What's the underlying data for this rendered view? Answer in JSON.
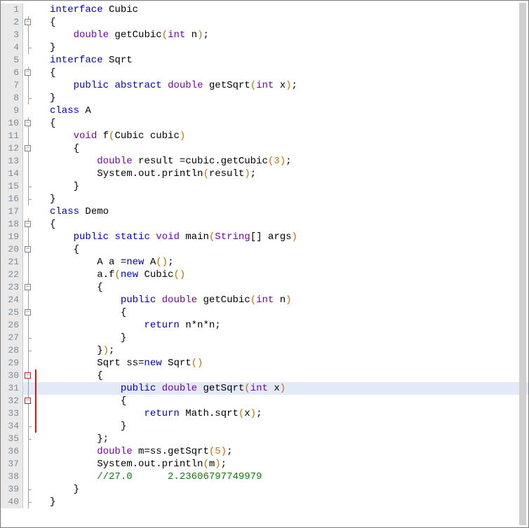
{
  "chart_data": {
    "language": "Java",
    "source": "interface Cubic\n{\n    double getCubic(int n);\n}\ninterface Sqrt\n{\n    public abstract double getSqrt(int x);\n}\nclass A\n{\n    void f(Cubic cubic)\n    {\n        double result =cubic.getCubic(3);\n        System.out.println(result);\n    }\n}\nclass Demo\n{\n    public static void main(String[] args)\n    {\n        A a =new A();\n        a.f(new Cubic()\n        {\n            public double getCubic(int n)\n            {\n                return n*n*n;\n            }\n        });\n        Sqrt ss=new Sqrt()\n        {\n            public double getSqrt(int x)\n            {\n                return Math.sqrt(x);\n            }\n        };\n        double m=ss.getSqrt(5);\n        System.out.println(m);\n        //27.0      2.23606797749979\n    }\n}\n"
  },
  "editor": {
    "highlighted_line": 31,
    "total_lines": 40
  },
  "lines": {
    "l1": {
      "n": "1",
      "t": [
        "interface",
        " Cubic"
      ]
    },
    "l2": {
      "n": "2",
      "t": [
        "{"
      ]
    },
    "l3": {
      "n": "3",
      "t": [
        "    ",
        "double",
        " getCubic",
        "(",
        "int",
        " n",
        ")",
        ";"
      ]
    },
    "l4": {
      "n": "4",
      "t": [
        "}"
      ]
    },
    "l5": {
      "n": "5",
      "t": [
        "interface",
        " Sqrt"
      ]
    },
    "l6": {
      "n": "6",
      "t": [
        "{"
      ]
    },
    "l7": {
      "n": "7",
      "t": [
        "    ",
        "public",
        " ",
        "abstract",
        " ",
        "double",
        " getSqrt",
        "(",
        "int",
        " x",
        ")",
        ";"
      ]
    },
    "l8": {
      "n": "8",
      "t": [
        "}"
      ]
    },
    "l9": {
      "n": "9",
      "t": [
        "class",
        " A"
      ]
    },
    "l10": {
      "n": "10",
      "t": [
        "{"
      ]
    },
    "l11": {
      "n": "11",
      "t": [
        "    ",
        "void",
        " f",
        "(",
        "Cubic cubic",
        ")"
      ]
    },
    "l12": {
      "n": "12",
      "t": [
        "    {"
      ]
    },
    "l13": {
      "n": "13",
      "t": [
        "        ",
        "double",
        " result =cubic.getCubic",
        "(",
        "3",
        ")",
        ";"
      ]
    },
    "l14": {
      "n": "14",
      "t": [
        "        System.out.println",
        "(",
        "result",
        ")",
        ";"
      ]
    },
    "l15": {
      "n": "15",
      "t": [
        "    }"
      ]
    },
    "l16": {
      "n": "16",
      "t": [
        "}"
      ]
    },
    "l17": {
      "n": "17",
      "t": [
        "class",
        " Demo"
      ]
    },
    "l18": {
      "n": "18",
      "t": [
        "{"
      ]
    },
    "l19": {
      "n": "19",
      "t": [
        "    ",
        "public",
        " ",
        "static",
        " ",
        "void",
        " main",
        "(",
        "String",
        "[] args",
        ")"
      ]
    },
    "l20": {
      "n": "20",
      "t": [
        "    {"
      ]
    },
    "l21": {
      "n": "21",
      "t": [
        "        A a =",
        "new",
        " A",
        "()",
        ";"
      ]
    },
    "l22": {
      "n": "22",
      "t": [
        "        a.f",
        "(",
        "new",
        " Cubic",
        "()"
      ]
    },
    "l23": {
      "n": "23",
      "t": [
        "        {"
      ]
    },
    "l24": {
      "n": "24",
      "t": [
        "            ",
        "public",
        " ",
        "double",
        " getCubic",
        "(",
        "int",
        " n",
        ")"
      ]
    },
    "l25": {
      "n": "25",
      "t": [
        "            {"
      ]
    },
    "l26": {
      "n": "26",
      "t": [
        "                ",
        "return",
        " n*n*n;"
      ]
    },
    "l27": {
      "n": "27",
      "t": [
        "            }"
      ]
    },
    "l28": {
      "n": "28",
      "t": [
        "        }",
        ")",
        ";"
      ]
    },
    "l29": {
      "n": "29",
      "t": [
        "        Sqrt ss=",
        "new",
        " Sqrt",
        "()"
      ]
    },
    "l30": {
      "n": "30",
      "t": [
        "        {"
      ]
    },
    "l31": {
      "n": "31",
      "t": [
        "            ",
        "public",
        " ",
        "double",
        " getSqrt",
        "(",
        "int",
        " x",
        ")"
      ]
    },
    "l32": {
      "n": "32",
      "t": [
        "            {"
      ]
    },
    "l33": {
      "n": "33",
      "t": [
        "                ",
        "return",
        " Math.sqrt",
        "(",
        "x",
        ")",
        ";"
      ]
    },
    "l34": {
      "n": "34",
      "t": [
        "            }"
      ]
    },
    "l35": {
      "n": "35",
      "t": [
        "        };"
      ]
    },
    "l36": {
      "n": "36",
      "t": [
        "        ",
        "double",
        " m=ss.getSqrt",
        "(",
        "5",
        ")",
        ";"
      ]
    },
    "l37": {
      "n": "37",
      "t": [
        "        System.out.println",
        "(",
        "m",
        ")",
        ";"
      ]
    },
    "l38": {
      "n": "38",
      "t": [
        "        ",
        "//27.0      2.23606797749979"
      ]
    },
    "l39": {
      "n": "39",
      "t": [
        "    }"
      ]
    },
    "l40": {
      "n": "40",
      "t": [
        "}"
      ]
    }
  },
  "token_class": {
    "interface": "kw",
    "class": "kw",
    "public": "kw",
    "abstract": "kw",
    "static": "kw",
    "void": "type",
    "double": "type",
    "int": "type",
    "return": "kw",
    "new": "kw",
    "String": "type"
  }
}
